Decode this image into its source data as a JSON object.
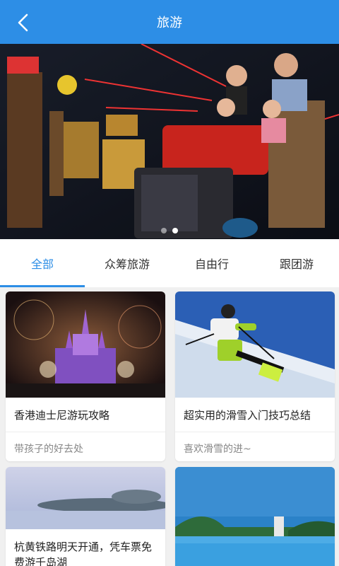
{
  "header": {
    "title": "旅游",
    "back_icon": "chevron-left-icon"
  },
  "banner": {
    "slide_count": 2,
    "active_slide": 2
  },
  "tabs": [
    {
      "label": "全部",
      "active": true
    },
    {
      "label": "众筹旅游",
      "active": false
    },
    {
      "label": "自由行",
      "active": false
    },
    {
      "label": "跟团游",
      "active": false
    }
  ],
  "cards": [
    {
      "title": "香港迪士尼游玩攻略",
      "subtitle": "带孩子的好去处"
    },
    {
      "title": "超实用的滑雪入门技巧总结",
      "subtitle": "喜欢滑雪的进~"
    },
    {
      "title": "杭黄铁路明天开通，凭车票免费游千岛湖",
      "subtitle": ""
    },
    {
      "title": "",
      "subtitle": ""
    }
  ],
  "colors": {
    "primary": "#2d8ee6",
    "background": "#f0f0f0"
  }
}
